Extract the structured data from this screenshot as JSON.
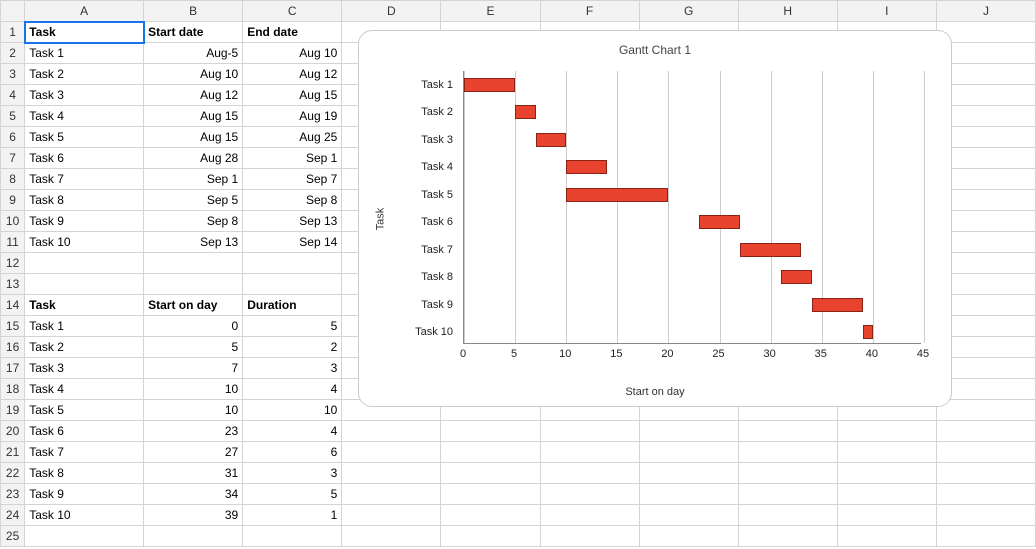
{
  "columns": [
    "A",
    "B",
    "C",
    "D",
    "E",
    "F",
    "G",
    "H",
    "I",
    "J"
  ],
  "rows": 25,
  "cell_active": "A1",
  "table1": {
    "headers": {
      "task": "Task",
      "start": "Start date",
      "end": "End date"
    },
    "rows": [
      {
        "task": "Task 1",
        "start": "Aug-5",
        "end": "Aug 10"
      },
      {
        "task": "Task 2",
        "start": "Aug 10",
        "end": "Aug 12"
      },
      {
        "task": "Task 3",
        "start": "Aug 12",
        "end": "Aug 15"
      },
      {
        "task": "Task 4",
        "start": "Aug 15",
        "end": "Aug 19"
      },
      {
        "task": "Task 5",
        "start": "Aug 15",
        "end": "Aug 25"
      },
      {
        "task": "Task 6",
        "start": "Aug 28",
        "end": "Sep 1"
      },
      {
        "task": "Task 7",
        "start": "Sep 1",
        "end": "Sep 7"
      },
      {
        "task": "Task 8",
        "start": "Sep 5",
        "end": "Sep 8"
      },
      {
        "task": "Task 9",
        "start": "Sep 8",
        "end": "Sep 13"
      },
      {
        "task": "Task 10",
        "start": "Sep 13",
        "end": "Sep 14"
      }
    ]
  },
  "table2": {
    "headers": {
      "task": "Task",
      "startday": "Start on day",
      "duration": "Duration"
    },
    "rows": [
      {
        "task": "Task 1",
        "startday": 0,
        "duration": 5
      },
      {
        "task": "Task 2",
        "startday": 5,
        "duration": 2
      },
      {
        "task": "Task 3",
        "startday": 7,
        "duration": 3
      },
      {
        "task": "Task 4",
        "startday": 10,
        "duration": 4
      },
      {
        "task": "Task 5",
        "startday": 10,
        "duration": 10
      },
      {
        "task": "Task 6",
        "startday": 23,
        "duration": 4
      },
      {
        "task": "Task 7",
        "startday": 27,
        "duration": 6
      },
      {
        "task": "Task 8",
        "startday": 31,
        "duration": 3
      },
      {
        "task": "Task 9",
        "startday": 34,
        "duration": 5
      },
      {
        "task": "Task 10",
        "startday": 39,
        "duration": 1
      }
    ]
  },
  "chart_data": {
    "type": "bar",
    "orientation": "horizontal-gantt",
    "title": "Gantt Chart 1",
    "xlabel": "Start on day",
    "ylabel": "Task",
    "xlim": [
      0,
      45
    ],
    "xticks": [
      0,
      5,
      10,
      15,
      20,
      25,
      30,
      35,
      40,
      45
    ],
    "categories": [
      "Task 1",
      "Task 2",
      "Task 3",
      "Task 4",
      "Task 5",
      "Task 6",
      "Task 7",
      "Task 8",
      "Task 9",
      "Task 10"
    ],
    "series": [
      {
        "name": "Start on day",
        "values": [
          0,
          5,
          7,
          10,
          10,
          23,
          27,
          31,
          34,
          39
        ],
        "role": "offset"
      },
      {
        "name": "Duration",
        "values": [
          5,
          2,
          3,
          4,
          10,
          4,
          6,
          3,
          5,
          1
        ],
        "role": "length"
      }
    ],
    "bar_color": "#e8432e"
  }
}
